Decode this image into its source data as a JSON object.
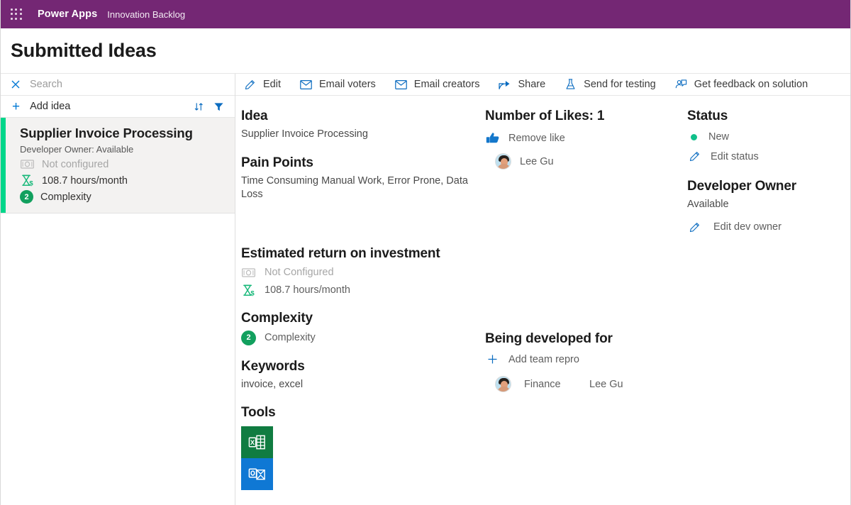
{
  "topbar": {
    "waffle_icon": "app-launcher-grid-icon",
    "brand": "Power Apps",
    "app_name": "Innovation Backlog",
    "bg_color": "#742774"
  },
  "page": {
    "title": "Submitted Ideas"
  },
  "left_pane": {
    "search": {
      "icon": "close-icon",
      "placeholder": "Search",
      "value": ""
    },
    "add_row": {
      "plus_icon": "plus-icon",
      "label": "Add idea",
      "sort_icon": "sort-icon",
      "filter_icon": "filter-icon"
    },
    "cards": [
      {
        "accent_color": "#00d68a",
        "title": "Supplier Invoice Processing",
        "subtitle": "Developer Owner: Available",
        "roi_money_icon": "money-icon",
        "roi_money_text": "Not configured",
        "roi_hours_icon": "hourglass-dollar-icon",
        "roi_hours_text": "108.7 hours/month",
        "complexity_badge": "2",
        "complexity_label": "Complexity",
        "badge_color": "#12a05e"
      }
    ]
  },
  "command_bar": {
    "items": [
      {
        "icon": "pencil-icon",
        "label": "Edit"
      },
      {
        "icon": "mail-icon",
        "label": "Email voters"
      },
      {
        "icon": "mail-icon",
        "label": "Email creators"
      },
      {
        "icon": "share-icon",
        "label": "Share"
      },
      {
        "icon": "beaker-icon",
        "label": "Send for testing"
      },
      {
        "icon": "feedback-person-icon",
        "label": "Get feedback on solution"
      }
    ]
  },
  "detail": {
    "idea": {
      "heading": "Idea",
      "value": "Supplier Invoice Processing"
    },
    "pain_points": {
      "heading": "Pain Points",
      "value": "Time Consuming Manual Work, Error Prone, Data Loss"
    },
    "roi": {
      "heading": "Estimated return on investment",
      "money_icon": "money-icon",
      "money_text": "Not Configured",
      "hours_icon": "hourglass-dollar-icon",
      "hours_text": "108.7 hours/month"
    },
    "complexity": {
      "heading": "Complexity",
      "badge": "2",
      "label": "Complexity"
    },
    "keywords": {
      "heading": "Keywords",
      "value": "invoice, excel"
    },
    "tools": {
      "heading": "Tools",
      "items": [
        {
          "icon": "excel-icon",
          "name": "Excel",
          "color": "#107c41"
        },
        {
          "icon": "outlook-icon",
          "name": "Outlook",
          "color": "#0f78d4"
        }
      ]
    },
    "likes": {
      "heading": "Number of Likes: 1",
      "action_icon": "thumbs-up-icon",
      "action_label": "Remove like",
      "voters": [
        {
          "avatar": "avatar",
          "name": "Lee Gu"
        }
      ]
    },
    "developed_for": {
      "heading": "Being developed for",
      "add_icon": "plus-icon",
      "add_label": "Add team repro",
      "rows": [
        {
          "avatar": "avatar",
          "team": "Finance",
          "person": "Lee Gu"
        }
      ]
    },
    "status": {
      "heading": "Status",
      "dot_color": "#10c08a",
      "value": "New",
      "edit_icon": "pencil-icon",
      "edit_label": "Edit status"
    },
    "developer_owner": {
      "heading": "Developer Owner",
      "value": "Available",
      "edit_icon": "pencil-icon",
      "edit_label": "Edit dev owner"
    }
  }
}
